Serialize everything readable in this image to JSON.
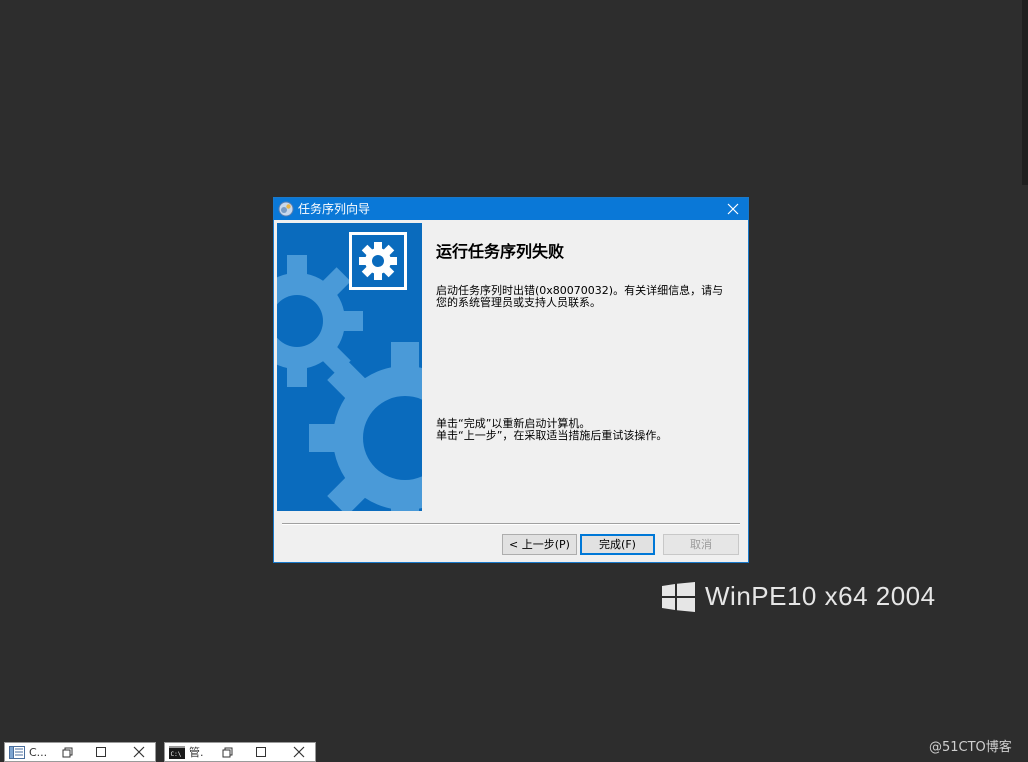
{
  "dialog": {
    "title": "任务序列向导",
    "heading": "运行任务序列失败",
    "message_lines": [
      "启动任务序列时出错(0x80070032)。有关详细信息，请与",
      "您的系统管理员或支持人员联系。"
    ],
    "instruction_lines": [
      "单击“完成”以重新启动计算机。",
      "单击“上一步”，在采取适当措施后重试该操作。"
    ],
    "buttons": {
      "back": "< 上一步(P)",
      "finish": "完成(F)",
      "cancel": "取消"
    }
  },
  "desktop": {
    "os_label": "WinPE10 x64 2004",
    "watermark": "@51CTO博客"
  },
  "minimized_windows": [
    {
      "title": "C...",
      "icon": "document-list-icon"
    },
    {
      "title": "管.",
      "icon": "command-prompt-icon"
    }
  ],
  "colors": {
    "desktop_bg": "#2d2d2d",
    "titlebar": "#0a78d7",
    "banner": "#0a6bbd",
    "banner_gear": "#4a9ad8",
    "dialog_bg": "#f0f0f0"
  }
}
